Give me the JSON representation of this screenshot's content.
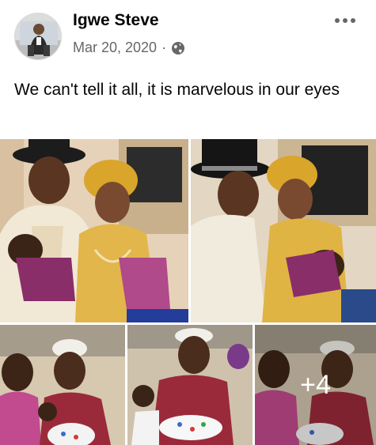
{
  "post": {
    "author": "Igwe Steve",
    "date": "Mar 20, 2020",
    "separator": "·",
    "privacy_icon": "globe-icon",
    "more_icon": "more-options-icon",
    "text": "We can't tell it all, it is marvelous in our eyes"
  },
  "photos": {
    "extra_count_label": "+4"
  },
  "colors": {
    "author_text": "#050505",
    "meta_text": "#65676b",
    "background": "#ffffff"
  }
}
